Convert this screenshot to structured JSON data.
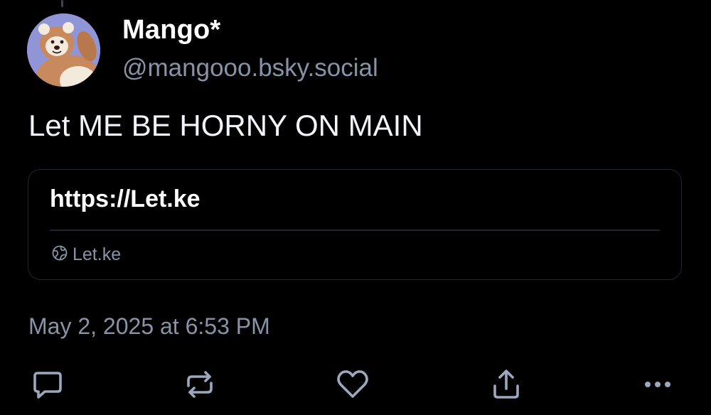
{
  "post": {
    "author": {
      "display_name": "Mango*",
      "handle": "@mangooo.bsky.social",
      "avatar_icon": "bear-avatar"
    },
    "text": "Let ME BE HORNY ON MAIN",
    "link_card": {
      "title": "https://Let.ke",
      "domain": "Let.ke",
      "domain_icon": "globe-icon"
    },
    "timestamp": "May 2, 2025 at 6:53 PM",
    "actions": [
      {
        "name": "reply",
        "icon": "comment-icon"
      },
      {
        "name": "repost",
        "icon": "repost-icon"
      },
      {
        "name": "like",
        "icon": "heart-icon"
      },
      {
        "name": "share",
        "icon": "share-icon"
      },
      {
        "name": "more",
        "icon": "more-dots-icon"
      }
    ]
  },
  "colors": {
    "background": "#000000",
    "text_primary": "#ffffff",
    "text_secondary": "#8794a8",
    "border": "#1f2630",
    "icon": "#9aa9be"
  }
}
